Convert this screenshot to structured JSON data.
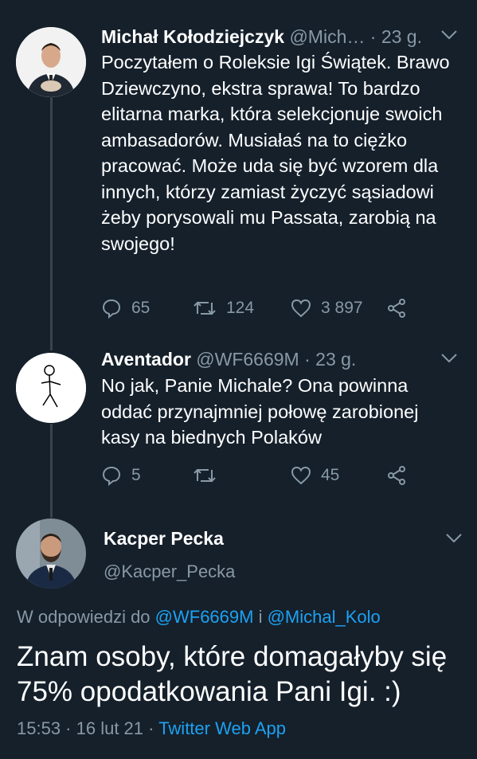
{
  "tweet1": {
    "name": "Michał Kołodziejczyk",
    "handle": "@Mich…",
    "sep": " · ",
    "time": "23 g.",
    "text": "Poczytałem o Roleksie Igi Świątek. Brawo Dziewczyno, ekstra sprawa! To bardzo elitarna marka, która selekcjonuje swoich ambasadorów. Musiałaś na to ciężko pracować. Może uda się być wzorem dla innych, którzy zamiast życzyć sąsiadowi żeby porysowali mu Passata, zarobią na swojego!",
    "replies": "65",
    "retweets": "124",
    "likes": "3 897"
  },
  "tweet2": {
    "name": "Aventador",
    "handle": "@WF6669M",
    "sep": " · ",
    "time": "23 g.",
    "text": "No jak, Panie Michale? Ona powinna oddać przynajmniej połowę zarobionej kasy na biednych Polaków",
    "replies": "5",
    "retweets": "",
    "likes": "45"
  },
  "main": {
    "name": "Kacper Pecka",
    "handle": "@Kacper_Pecka",
    "reply_prefix": "W odpowiedzi do ",
    "reply_user1": "@WF6669M",
    "reply_and": " i ",
    "reply_user2": "@Michal_Kolo",
    "text": "Znam osoby, które domagałyby się 75% opodatkowania Pani Igi. :)",
    "time": "15:53",
    "sep1": " · ",
    "date": "16 lut 21",
    "sep2": " · ",
    "source": "Twitter Web App"
  },
  "icons": [
    "reply-icon",
    "retweet-icon",
    "like-icon",
    "share-icon",
    "chevron-down-icon"
  ],
  "colors": {
    "background": "#15202b",
    "muted": "#8899a6",
    "link": "#1da1f2",
    "thread_line": "#38444d"
  }
}
